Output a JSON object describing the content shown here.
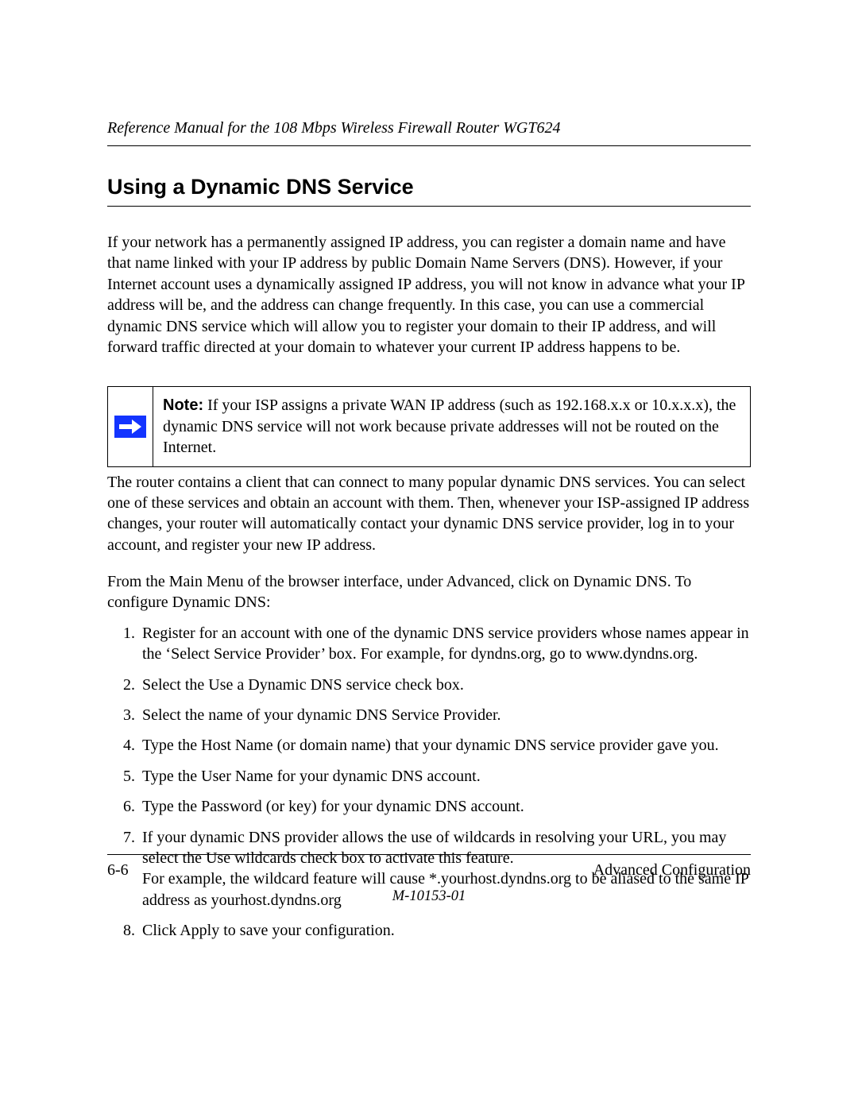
{
  "header": {
    "running_title": "Reference Manual for the 108 Mbps Wireless Firewall Router WGT624"
  },
  "section": {
    "title": "Using a Dynamic DNS Service",
    "intro": "If your network has a permanently assigned IP address, you can register a domain name and have that name linked with your IP address by public Domain Name Servers (DNS). However, if your Internet account uses a dynamically assigned IP address, you will not know in advance what your IP address will be, and the address can change frequently. In this case, you can use a commercial dynamic DNS service which will allow you to register your domain to their IP address, and will forward traffic directed at your domain to whatever your current IP address happens to be.",
    "note": {
      "label": "Note:",
      "body": "If your ISP assigns a private WAN IP address (such as 192.168.x.x or 10.x.x.x), the dynamic DNS service will not work because private addresses will not be routed on the Internet."
    },
    "after_note_1": "The router contains a client that can connect to many popular dynamic DNS services. You can select one of these services and obtain an account with them. Then, whenever your ISP-assigned IP address changes, your router will automatically contact your dynamic DNS service provider, log in to your account, and register your new IP address.",
    "after_note_2": "From the Main Menu of the browser interface, under Advanced, click on Dynamic DNS. To configure Dynamic DNS:",
    "steps": [
      "Register for an account with one of the dynamic DNS service providers whose names appear in the ‘Select Service Provider’ box. For example, for dyndns.org, go to www.dyndns.org.",
      "Select the Use a Dynamic DNS service check box.",
      "Select the name of your dynamic DNS Service Provider.",
      "Type the Host Name (or domain name) that your dynamic DNS service provider gave you.",
      "Type the User Name for your dynamic DNS account.",
      "Type the Password (or key) for your dynamic DNS account.",
      "If your dynamic DNS provider allows the use of wildcards in resolving your URL, you may select the Use wildcards check box to activate this feature.\nFor example, the wildcard feature will cause *.yourhost.dyndns.org to be aliased to the same IP address as yourhost.dyndns.org",
      "Click Apply to save your configuration."
    ]
  },
  "footer": {
    "page_num": "6-6",
    "chapter": "Advanced Configuration",
    "doc_id": "M-10153-01"
  }
}
